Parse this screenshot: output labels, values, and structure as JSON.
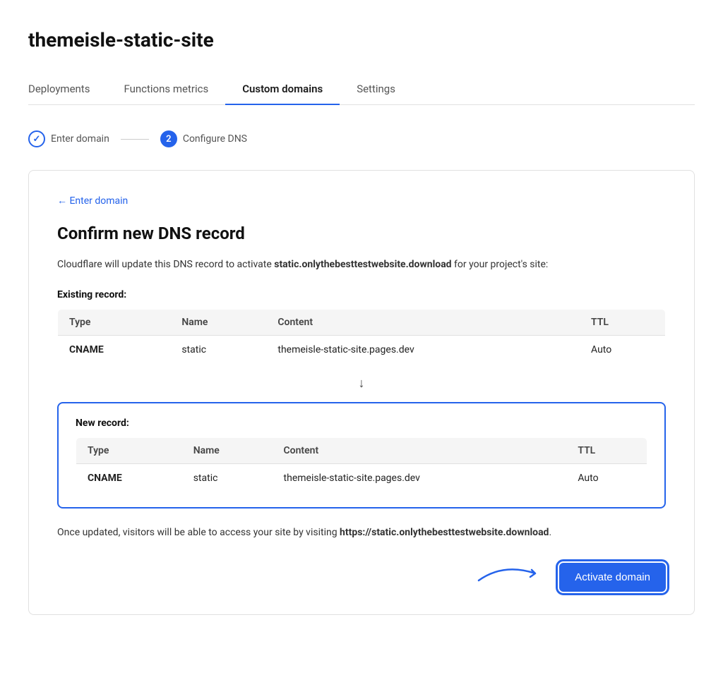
{
  "page": {
    "title": "themeisle-static-site"
  },
  "tabs": [
    {
      "id": "deployments",
      "label": "Deployments",
      "active": false
    },
    {
      "id": "functions-metrics",
      "label": "Functions metrics",
      "active": false
    },
    {
      "id": "custom-domains",
      "label": "Custom domains",
      "active": true
    },
    {
      "id": "settings",
      "label": "Settings",
      "active": false
    }
  ],
  "stepper": {
    "step1": {
      "label": "Enter domain",
      "state": "done",
      "icon": "✓"
    },
    "step2": {
      "label": "Configure DNS",
      "state": "active",
      "number": "2"
    }
  },
  "card": {
    "back_link": "← Enter domain",
    "title": "Confirm new DNS record",
    "description_before": "Cloudflare will update this DNS record to activate ",
    "domain_highlight": "static.onlythebesttestwebsite.download",
    "description_after": " for your project's site:",
    "existing_record_label": "Existing record:",
    "existing_table": {
      "headers": [
        "Type",
        "Name",
        "Content",
        "TTL"
      ],
      "rows": [
        {
          "type": "CNAME",
          "name": "static",
          "content": "themeisle-static-site.pages.dev",
          "ttl": "Auto"
        }
      ]
    },
    "new_record_label": "New record:",
    "new_table": {
      "headers": [
        "Type",
        "Name",
        "Content",
        "TTL"
      ],
      "rows": [
        {
          "type": "CNAME",
          "name": "static",
          "content": "themeisle-static-site.pages.dev",
          "ttl": "Auto"
        }
      ]
    },
    "footer_before": "Once updated, visitors will be able to access your site by visiting ",
    "footer_url": "https://static.onlythebesttestwebsite.download",
    "footer_after": ".",
    "activate_button": "Activate domain"
  }
}
